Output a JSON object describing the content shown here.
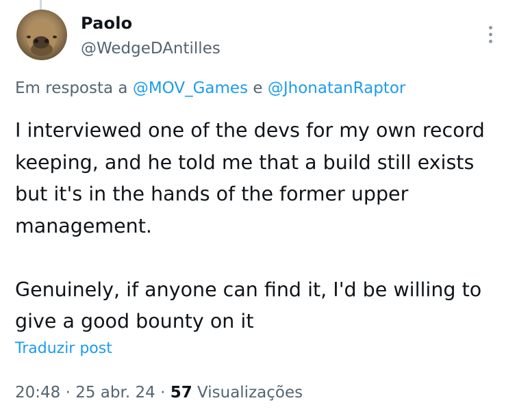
{
  "author": {
    "name": "Paolo",
    "handle": "@WedgeDAntilles",
    "avatar_icon": "avatar-photo"
  },
  "menu": {
    "icon": "more-options-icon"
  },
  "reply": {
    "prefix": "Em resposta a",
    "mention_1": "@MOV_Games",
    "joiner": "e",
    "mention_2": "@JhonatanRaptor"
  },
  "post": {
    "text": "I interviewed one of the devs for my own record keeping, and he told me that a build still exists but it's in the hands of the former upper management.\n\nGenuinely, if anyone can find it, I'd be willing to give a good bounty on it"
  },
  "translate_label": "Traduzir post",
  "meta": {
    "time": "20:48",
    "separator": "·",
    "date": "25 abr. 24",
    "views_count": "57",
    "views_label": "Visualizações"
  },
  "colors": {
    "link": "#1d9bf0",
    "secondary_text": "#536471",
    "primary_text": "#0f1419"
  }
}
